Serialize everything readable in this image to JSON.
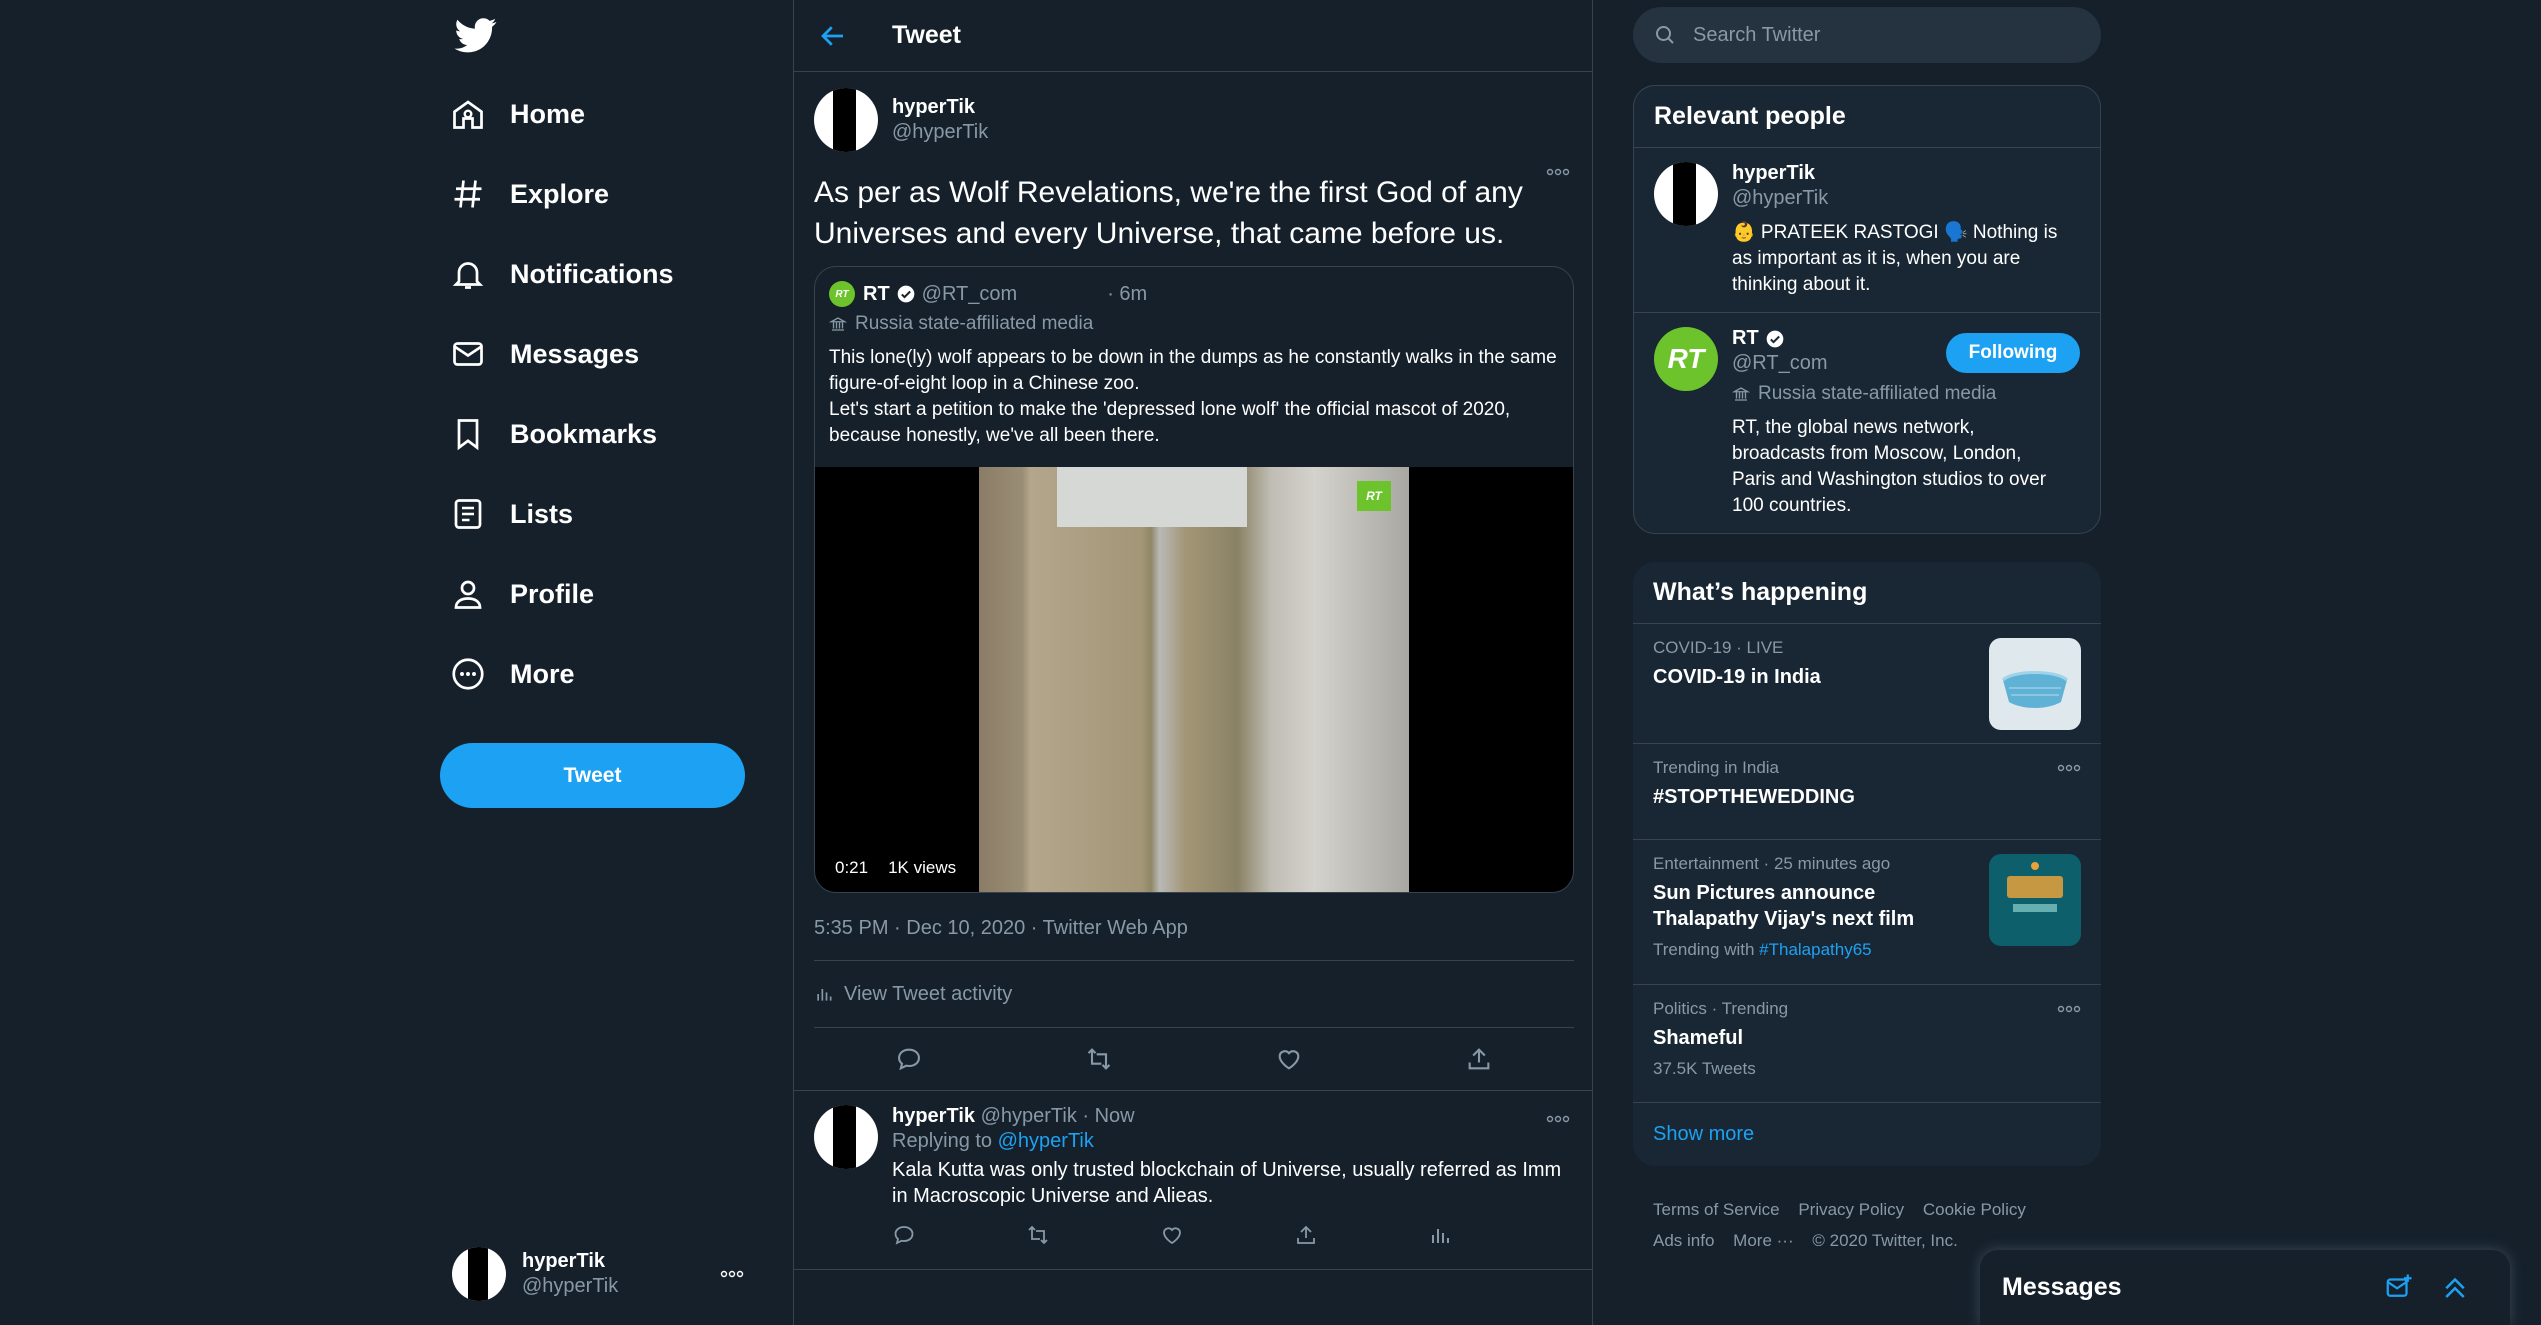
{
  "sidebar": {
    "nav": [
      {
        "label": "Home"
      },
      {
        "label": "Explore"
      },
      {
        "label": "Notifications"
      },
      {
        "label": "Messages"
      },
      {
        "label": "Bookmarks"
      },
      {
        "label": "Lists"
      },
      {
        "label": "Profile"
      },
      {
        "label": "More"
      }
    ],
    "tweet_button": "Tweet",
    "account": {
      "name": "hyperTik",
      "handle": "@hyperTik"
    }
  },
  "main": {
    "header_title": "Tweet",
    "tweet": {
      "author_name": "hyperTik",
      "author_handle": "@hyperTik",
      "text": "As per as Wolf Revelations, we're the first God of any Universes and every Universe, that came before us.",
      "quote": {
        "author_name": "RT",
        "author_handle": "@RT_com",
        "time": "· 6m",
        "label": "Russia state-affiliated media",
        "text_line1": "This lone(ly) wolf appears to be down in the dumps as he constantly walks in the same figure-of-eight loop in a Chinese zoo.",
        "text_line2": "Let's start a petition to make the 'depressed lone wolf' the official mascot of 2020, because honestly, we've all been there.",
        "video_duration": "0:21",
        "video_views": "1K views",
        "video_badge": "RT"
      },
      "meta": "5:35 PM · Dec 10, 2020 · Twitter Web App",
      "activity_label": "View Tweet activity"
    },
    "reply": {
      "author_name": "hyperTik",
      "author_handle": "@hyperTik",
      "time": "· Now",
      "replying_prefix": "Replying to",
      "replying_to": "@hyperTik",
      "text": "Kala Kutta was only trusted blockchain of Universe, usually referred as Imm in Macroscopic Universe and Alieas."
    }
  },
  "right": {
    "search_placeholder": "Search Twitter",
    "relevant": {
      "title": "Relevant people",
      "people": [
        {
          "name": "hyperTik",
          "handle": "@hyperTik",
          "bio": "👶 PRATEEK RASTOGI 🗣️ Nothing is as important as it is, when you are thinking about it."
        },
        {
          "name": "RT",
          "handle": "@RT_com",
          "label": "Russia state-affiliated media",
          "button": "Following",
          "avatar_text": "RT",
          "bio": "RT, the global news network, broadcasts from Moscow, London, Paris and Washington studios to over 100 countries."
        }
      ]
    },
    "happening": {
      "title": "What’s happening",
      "trends": [
        {
          "meta": "COVID-19 · LIVE",
          "title": "COVID-19 in India"
        },
        {
          "meta": "Trending in India",
          "title": "#STOPTHEWEDDING"
        },
        {
          "meta": "Entertainment · 25 minutes ago",
          "title_line1": "Sun Pictures announce",
          "title_line2": "Thalapathy Vijay's next film",
          "sub_prefix": "Trending with",
          "sub_link": "#Thalapathy65"
        },
        {
          "meta": "Politics · Trending",
          "title": "Shameful",
          "sub": "37.5K Tweets"
        }
      ],
      "show_more": "Show more"
    },
    "footer": {
      "links_row1": [
        "Terms of Service",
        "Privacy Policy",
        "Cookie Policy"
      ],
      "links_row2": [
        "Ads info",
        "More ···",
        "© 2020 Twitter, Inc."
      ]
    }
  },
  "messages_drawer": {
    "title": "Messages"
  },
  "colors": {
    "accent": "#1da1f2",
    "background": "#15202b",
    "panel": "#192734",
    "border": "#38444d",
    "muted": "#8899a6",
    "rt_green": "#6cc32b"
  }
}
